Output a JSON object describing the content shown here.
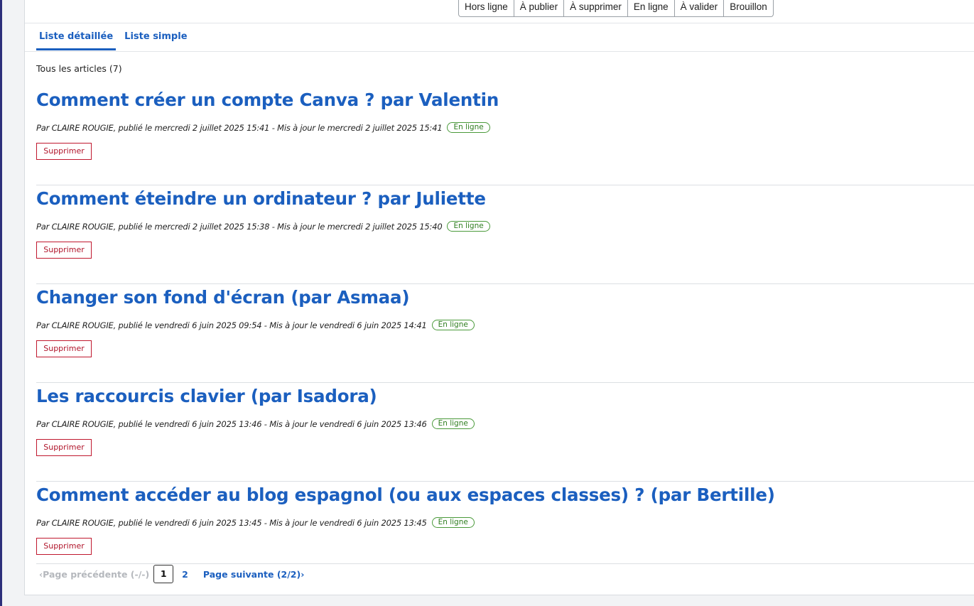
{
  "filters": [
    "Hors ligne",
    "À publier",
    "À supprimer",
    "En ligne",
    "À valider",
    "Brouillon"
  ],
  "tabs": [
    {
      "label": "Liste détaillée",
      "active": true
    },
    {
      "label": "Liste simple",
      "active": false
    }
  ],
  "count_text": "Tous les articles (7)",
  "articles": [
    {
      "title": "Comment créer un compte Canva ? par Valentin",
      "meta": "Par CLAIRE ROUGIE, publié le mercredi 2 juillet 2025 15:41 - Mis à jour le mercredi 2 juillet 2025 15:41",
      "status": "En ligne",
      "delete_label": "Supprimer"
    },
    {
      "title": "Comment éteindre un ordinateur ? par Juliette",
      "meta": "Par CLAIRE ROUGIE, publié le mercredi 2 juillet 2025 15:38 - Mis à jour le mercredi 2 juillet 2025 15:40",
      "status": "En ligne",
      "delete_label": "Supprimer"
    },
    {
      "title": "Changer son fond d'écran (par Asmaa)",
      "meta": "Par CLAIRE ROUGIE, publié le vendredi 6 juin 2025 09:54 - Mis à jour le vendredi 6 juin 2025 14:41",
      "status": "En ligne",
      "delete_label": "Supprimer"
    },
    {
      "title": "Les raccourcis clavier (par Isadora)",
      "meta": "Par CLAIRE ROUGIE, publié le vendredi 6 juin 2025 13:46 - Mis à jour le vendredi 6 juin 2025 13:46",
      "status": "En ligne",
      "delete_label": "Supprimer"
    },
    {
      "title": "Comment accéder au blog espagnol (ou aux espaces classes) ? (par Bertille)",
      "meta": "Par CLAIRE ROUGIE, publié le vendredi 6 juin 2025 13:45 - Mis à jour le vendredi 6 juin 2025 13:45",
      "status": "En ligne",
      "delete_label": "Supprimer"
    }
  ],
  "pagination": {
    "prev": "‹Page précédente  (-/-)",
    "current": "1",
    "page2": "2",
    "next": "Page suivante  (2/2)›"
  },
  "colors": {
    "link": "#1b5fbf",
    "danger": "#c0182e",
    "status": "#2e7d1f"
  }
}
